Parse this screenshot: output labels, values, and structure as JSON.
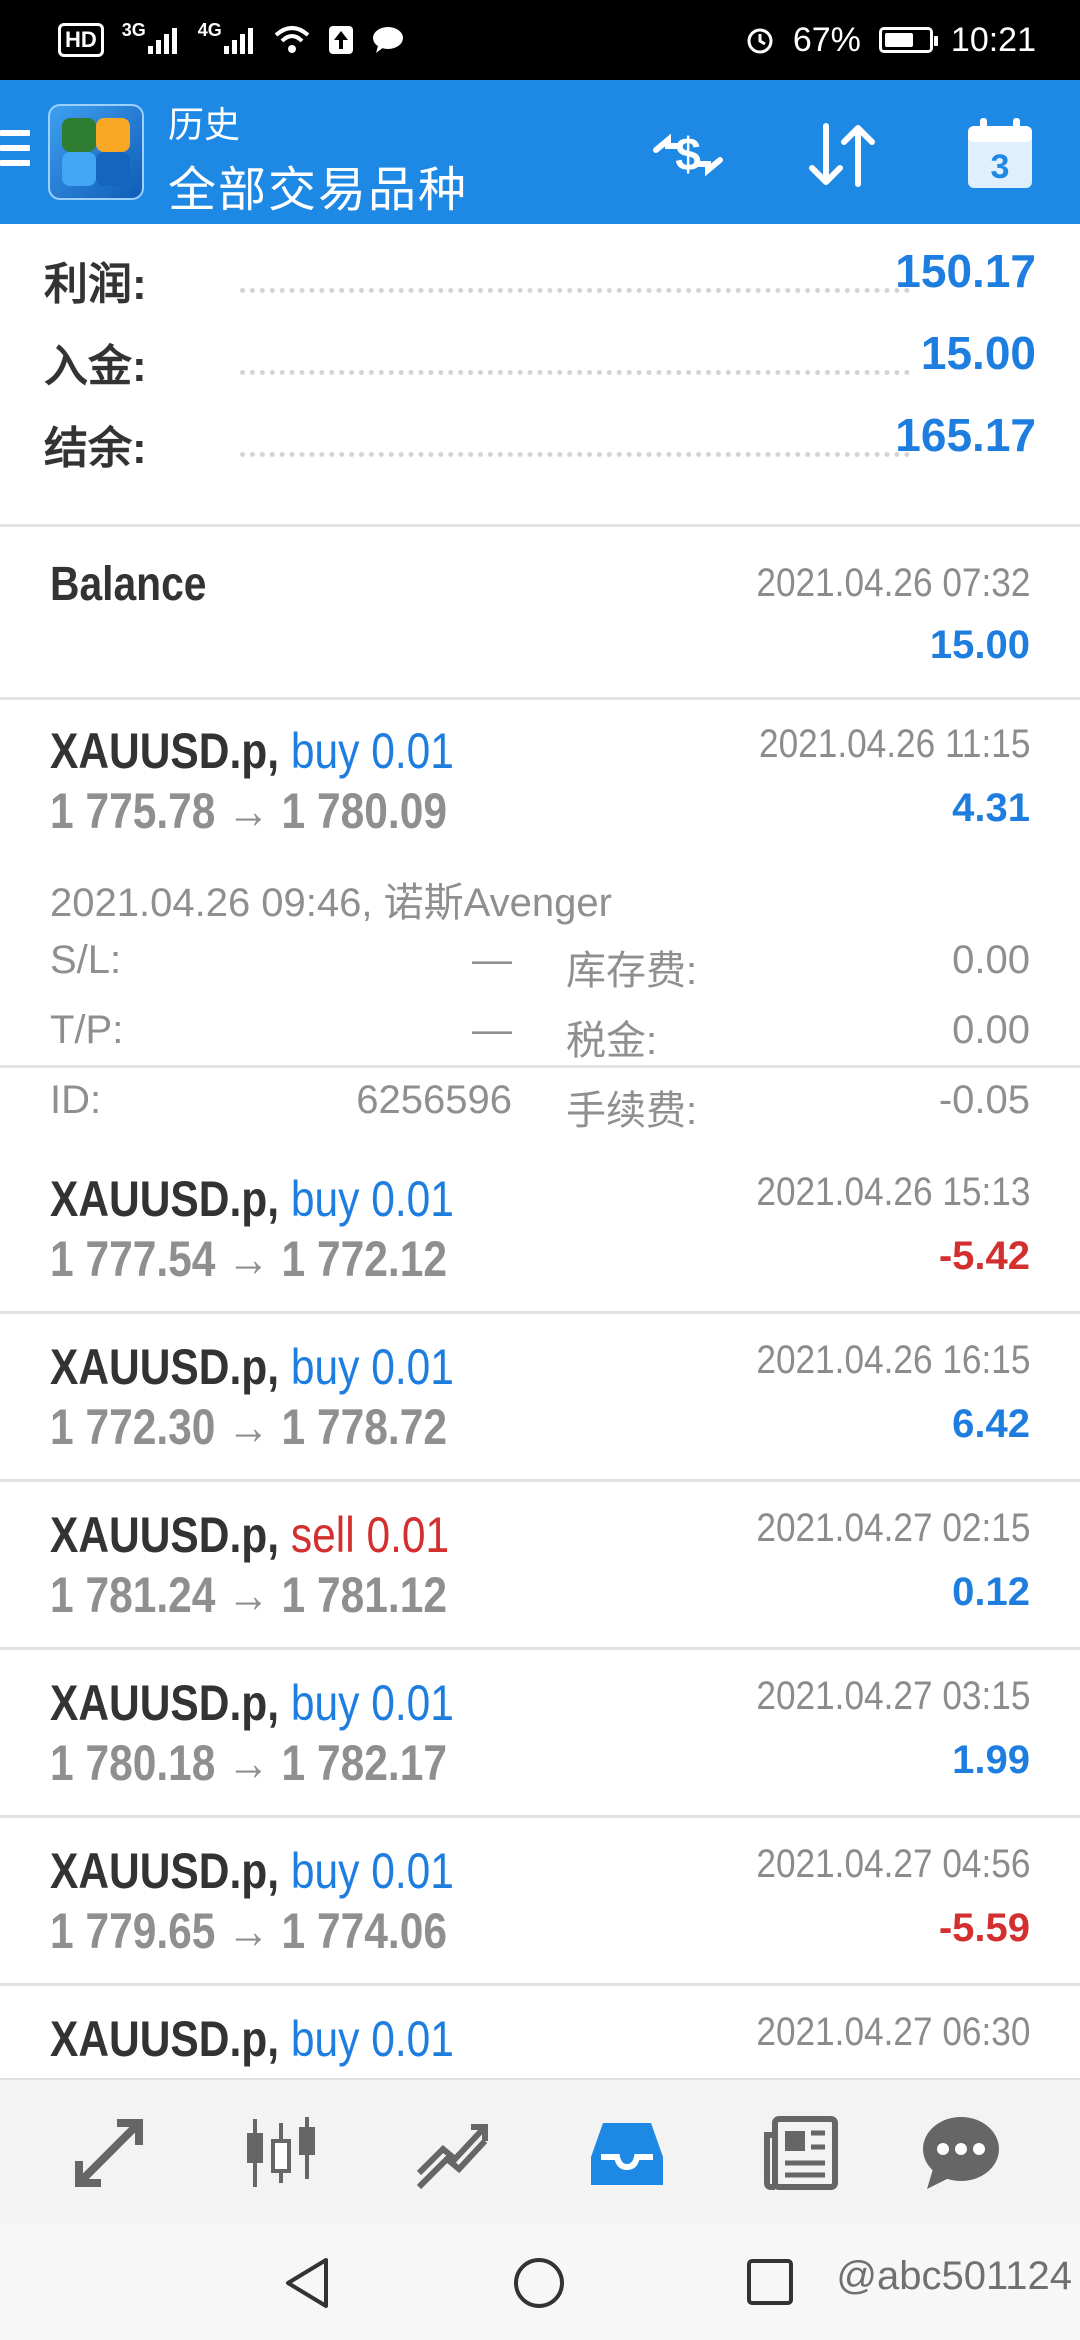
{
  "status_bar": {
    "hd": "HD",
    "net1": "3G",
    "net2": "4G",
    "battery_pct": "67%",
    "battery_level": 0.67,
    "time": "10:21"
  },
  "app_bar": {
    "subtitle": "历史",
    "title": "全部交易品种",
    "calendar_day": "3",
    "icons": [
      "menu-icon",
      "app-logo",
      "deposit-withdraw-icon",
      "sort-icon",
      "calendar-icon"
    ]
  },
  "summary": [
    {
      "label": "利润:",
      "value": "150.17"
    },
    {
      "label": "入金:",
      "value": "15.00"
    },
    {
      "label": "结余:",
      "value": "165.17"
    }
  ],
  "balance": {
    "label": "Balance",
    "time": "2021.04.26 07:32",
    "amount": "15.00"
  },
  "trades": [
    {
      "symbol": "XAUUSD.p,",
      "dir": "buy 0.01",
      "type": "buy",
      "prices": "1 775.78 → 1 780.09",
      "time": "2021.04.26 11:15",
      "profit": "4.31",
      "positive": true
    },
    {
      "symbol": "XAUUSD.p,",
      "dir": "buy 0.01",
      "type": "buy",
      "prices": "1 777.54 → 1 772.12",
      "time": "2021.04.26 15:13",
      "profit": "-5.42",
      "positive": false
    },
    {
      "symbol": "XAUUSD.p,",
      "dir": "buy 0.01",
      "type": "buy",
      "prices": "1 772.30 → 1 778.72",
      "time": "2021.04.26 16:15",
      "profit": "6.42",
      "positive": true
    },
    {
      "symbol": "XAUUSD.p,",
      "dir": "sell 0.01",
      "type": "sell",
      "prices": "1 781.24 → 1 781.12",
      "time": "2021.04.27 02:15",
      "profit": "0.12",
      "positive": true
    },
    {
      "symbol": "XAUUSD.p,",
      "dir": "buy 0.01",
      "type": "buy",
      "prices": "1 780.18 → 1 782.17",
      "time": "2021.04.27 03:15",
      "profit": "1.99",
      "positive": true
    },
    {
      "symbol": "XAUUSD.p,",
      "dir": "buy 0.01",
      "type": "buy",
      "prices": "1 779.65 → 1 774.06",
      "time": "2021.04.27 04:56",
      "profit": "-5.59",
      "positive": false
    },
    {
      "symbol": "XAUUSD.p,",
      "dir": "buy 0.01",
      "type": "buy",
      "prices": "",
      "time": "2021.04.27 06:30",
      "profit": "",
      "positive": true
    }
  ],
  "expanded_detail": {
    "open_line": "2021.04.26 09:46, 诺斯Avenger",
    "sl_label": "S/L:",
    "sl_value": "—",
    "swap_label": "库存费:",
    "swap_value": "0.00",
    "tp_label": "T/P:",
    "tp_value": "—",
    "tax_label": "税金:",
    "tax_value": "0.00",
    "id_label": "ID:",
    "id_value": "6256596",
    "fee_label": "手续费:",
    "fee_value": "-0.05"
  },
  "bottom_nav": [
    {
      "name": "quotes-tab",
      "icon": "arrows-icon",
      "active": false
    },
    {
      "name": "chart-tab",
      "icon": "candlestick-icon",
      "active": false
    },
    {
      "name": "trade-tab",
      "icon": "trend-icon",
      "active": false
    },
    {
      "name": "history-tab",
      "icon": "inbox-icon",
      "active": true
    },
    {
      "name": "news-tab",
      "icon": "newspaper-icon",
      "active": false
    },
    {
      "name": "messages-tab",
      "icon": "chat-icon",
      "active": false
    }
  ],
  "watermark": "@abc501124",
  "colors": {
    "accent": "#1e88e5",
    "profit": "#1e7ee0",
    "loss": "#d32f2f",
    "muted": "#8f8f8f"
  }
}
